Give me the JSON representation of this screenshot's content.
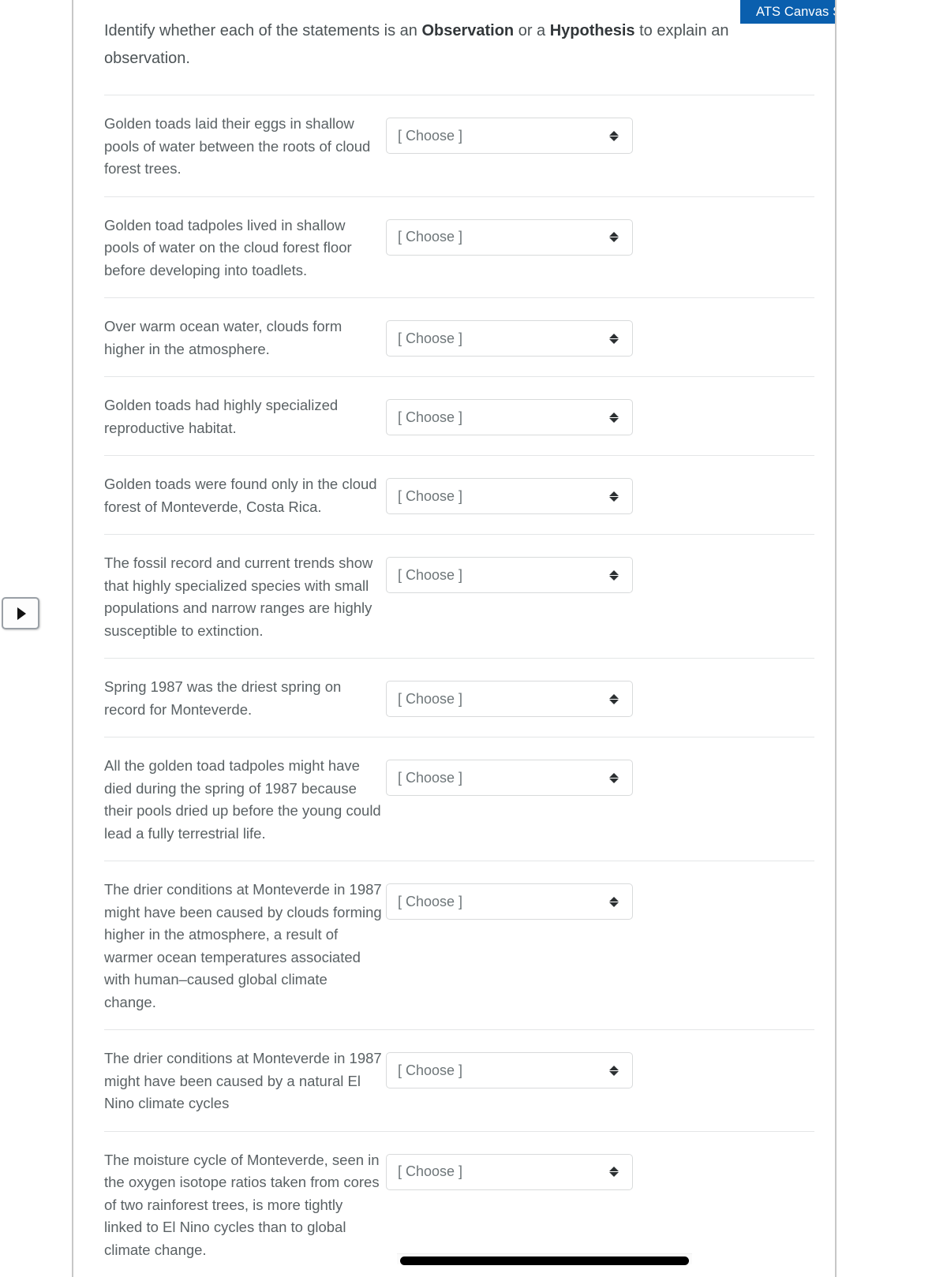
{
  "support_badge": {
    "label": "ATS Canvas Support",
    "help_icon": "?",
    "background_color": "#0a5fae",
    "icon_color": "#4a9bdc"
  },
  "expand_handle": {
    "icon": "play-triangle"
  },
  "prompt": {
    "lead": "Identify whether each of the statements is an ",
    "bold_1": "Observation",
    "middle": " or a ",
    "bold_2": "Hypothesis",
    "tail": " to explain an observation."
  },
  "dropdown": {
    "placeholder": "[ Choose ]",
    "chevron": "up-down-chevron"
  },
  "rows": [
    {
      "statement": "Golden toads laid their eggs in shallow pools of water between the roots of cloud forest trees.",
      "value": "[ Choose ]"
    },
    {
      "statement": "Golden toad tadpoles lived in shallow pools of water on the cloud forest floor before developing into toadlets.",
      "value": "[ Choose ]"
    },
    {
      "statement": "Over warm ocean water, clouds form higher in the atmosphere.",
      "value": "[ Choose ]"
    },
    {
      "statement": "Golden toads had highly specialized reproductive habitat.",
      "value": "[ Choose ]"
    },
    {
      "statement": "Golden toads were found only in the cloud forest of Monteverde, Costa Rica.",
      "value": "[ Choose ]"
    },
    {
      "statement": "The fossil record and current trends show that highly specialized species with small populations and narrow ranges are highly susceptible to extinction.",
      "value": "[ Choose ]"
    },
    {
      "statement": "Spring 1987 was the driest spring on record for Monteverde.",
      "value": "[ Choose ]"
    },
    {
      "statement": "All the golden toad tadpoles might have died during the spring of 1987 because their pools dried up before the young could lead a fully terrestrial life.",
      "value": "[ Choose ]"
    },
    {
      "statement": "The drier conditions at Monteverde in 1987 might have been caused by clouds forming higher in the atmosphere, a result of warmer ocean temperatures associated with human–caused global climate change.",
      "value": "[ Choose ]"
    },
    {
      "statement": "The drier conditions at Monteverde in 1987 might have been caused by a natural El Nino climate cycles",
      "value": "[ Choose ]"
    },
    {
      "statement": "The moisture cycle of Monteverde, seen in the oxygen isotope ratios taken from cores of two rainforest trees, is more tightly linked to El Nino cycles than to global climate change.",
      "value": "[ Choose ]"
    }
  ],
  "scrollbar": {
    "orientation": "horizontal",
    "thumb_color": "#000000"
  }
}
